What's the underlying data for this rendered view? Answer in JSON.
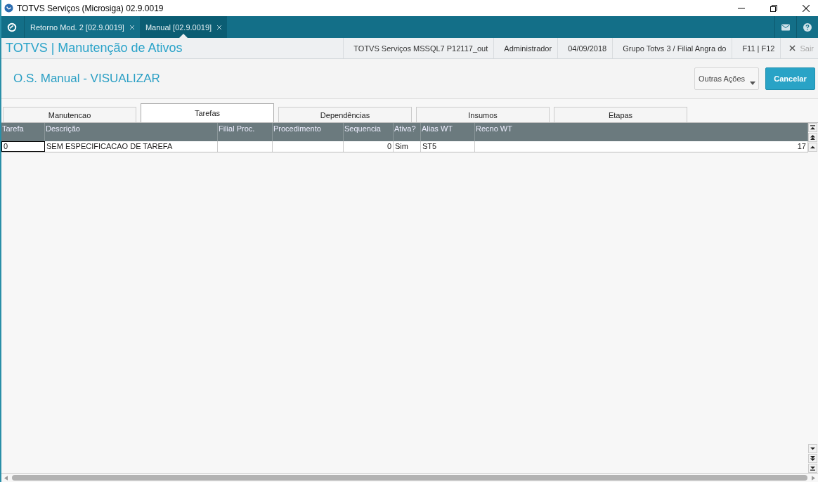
{
  "window": {
    "title": "TOTVS Serviços (Microsiga) 02.9.0019"
  },
  "nav_tabs": [
    {
      "label": "Retorno Mod. 2 [02.9.0019]",
      "selected": false
    },
    {
      "label": "Manual [02.9.0019]",
      "selected": true
    }
  ],
  "header": {
    "module_title": "TOTVS | Manutenção de Ativos",
    "info": [
      "TOTVS Serviços MSSQL7 P12117_out",
      "Administrador",
      "04/09/2018",
      "Grupo Totvs 3 / Filial Angra do",
      "F11 | F12"
    ],
    "exit_label": "Sair"
  },
  "page": {
    "title": "O.S. Manual - VISUALIZAR",
    "actions": [
      {
        "label": "Outras Ações",
        "kind": "menu"
      },
      {
        "label": "Cancelar",
        "kind": "primary"
      }
    ]
  },
  "folder_tabs": [
    {
      "label": "Manutencao",
      "selected": false
    },
    {
      "label": "Tarefas",
      "selected": true
    },
    {
      "label": "Dependências",
      "selected": false
    },
    {
      "label": "Insumos",
      "selected": false
    },
    {
      "label": "Etapas",
      "selected": false
    }
  ],
  "table": {
    "columns": [
      {
        "label": "Tarefa",
        "kind": "text"
      },
      {
        "label": "Descrição",
        "kind": "text"
      },
      {
        "label": "Filial Proc.",
        "kind": "text"
      },
      {
        "label": "Procedimento",
        "kind": "text"
      },
      {
        "label": "Sequencia",
        "kind": "number"
      },
      {
        "label": "Ativa?",
        "kind": "text"
      },
      {
        "label": "Alias WT",
        "kind": "text"
      },
      {
        "label": "Recno WT",
        "kind": "number"
      }
    ],
    "rows": [
      {
        "cells": [
          {
            "text": "0",
            "focused": true
          },
          {
            "text": "SEM ESPECIFICACAO DE TAREFA",
            "focused": false
          },
          {
            "focused": false
          },
          {
            "focused": false
          },
          {
            "text": "0",
            "focused": false
          },
          {
            "text": "Sim",
            "focused": false
          },
          {
            "text": "ST5",
            "focused": false
          },
          {
            "text": "17",
            "focused": false
          }
        ]
      }
    ]
  }
}
